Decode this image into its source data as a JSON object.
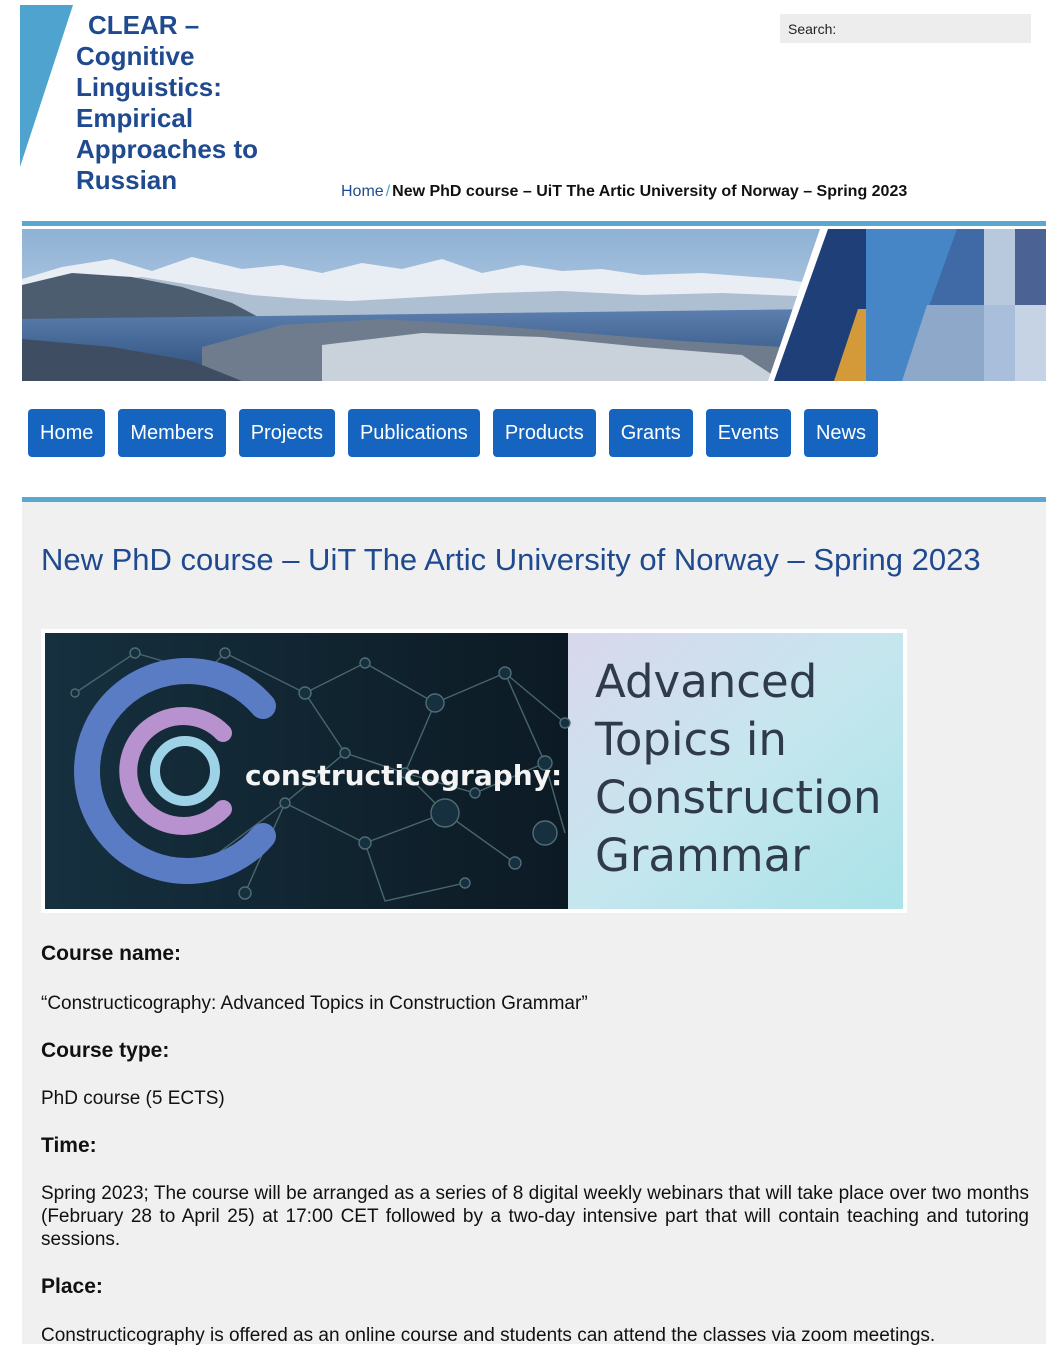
{
  "site": {
    "title_line1": "CLEAR –",
    "title_line2": "Cognitive Linguistics: Empirical Approaches to Russian",
    "brand_color": "#1f4a8f",
    "accent_color": "#5aa7cf"
  },
  "search": {
    "label": "Search:",
    "value": ""
  },
  "breadcrumb": {
    "home": "Home",
    "separator": "/",
    "current": "New PhD course – UiT The Artic University of Norway – Spring 2023"
  },
  "nav": {
    "button_color": "#1565c0",
    "items": [
      {
        "label": "Home"
      },
      {
        "label": "Members"
      },
      {
        "label": "Projects"
      },
      {
        "label": "Publications"
      },
      {
        "label": "Products"
      },
      {
        "label": "Grants"
      },
      {
        "label": "Events"
      },
      {
        "label": "News"
      }
    ]
  },
  "page": {
    "title": "New PhD course – UiT The Artic University of Norway – Spring 2023",
    "course_image": {
      "logo_text": "constructicography:",
      "line1": "Advanced",
      "line2": "Topics in",
      "line3": "Construction",
      "line4": "Grammar"
    },
    "sections": [
      {
        "heading": "Course name:",
        "text": "“Constructicography: Advanced Topics in Construction Grammar”"
      },
      {
        "heading": "Course type:",
        "text": "PhD course (5 ECTS)"
      },
      {
        "heading": "Time:",
        "text": "Spring 2023; The course will be arranged as a series of 8 digital weekly webinars that will take place over two months (February 28 to April 25) at 17:00 CET followed by a two-day intensive part that will contain teaching and tutoring sessions."
      },
      {
        "heading": "Place:",
        "text": "Constructicography is offered as an online course and students can attend the classes via zoom meetings."
      }
    ]
  }
}
